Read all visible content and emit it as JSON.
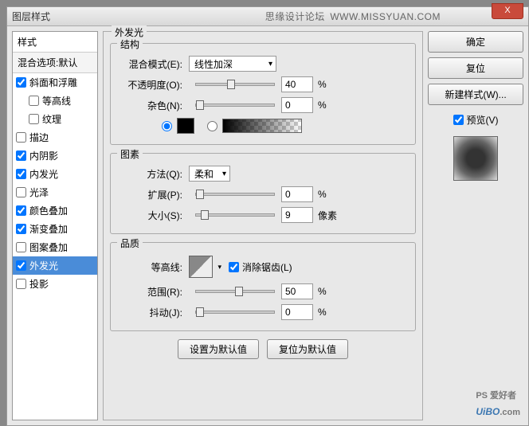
{
  "titlebar": {
    "title": "图层样式",
    "brand": "思缘设计论坛",
    "url": "WWW.MISSYUAN.COM"
  },
  "close": "X",
  "sidebar": {
    "header": "样式",
    "sub": "混合选项:默认",
    "items": [
      {
        "label": "斜面和浮雕",
        "checked": true,
        "indent": false
      },
      {
        "label": "等高线",
        "checked": false,
        "indent": true
      },
      {
        "label": "纹理",
        "checked": false,
        "indent": true
      },
      {
        "label": "描边",
        "checked": false,
        "indent": false
      },
      {
        "label": "内阴影",
        "checked": true,
        "indent": false
      },
      {
        "label": "内发光",
        "checked": true,
        "indent": false
      },
      {
        "label": "光泽",
        "checked": false,
        "indent": false
      },
      {
        "label": "颜色叠加",
        "checked": true,
        "indent": false
      },
      {
        "label": "渐变叠加",
        "checked": true,
        "indent": false
      },
      {
        "label": "图案叠加",
        "checked": false,
        "indent": false
      },
      {
        "label": "外发光",
        "checked": true,
        "indent": false,
        "selected": true
      },
      {
        "label": "投影",
        "checked": false,
        "indent": false
      }
    ]
  },
  "main": {
    "outer_title": "外发光",
    "structure": {
      "title": "结构",
      "blend_label": "混合模式(E):",
      "blend_value": "线性加深",
      "opacity_label": "不透明度(O):",
      "opacity_value": "40",
      "opacity_unit": "%",
      "noise_label": "杂色(N):",
      "noise_value": "0",
      "noise_unit": "%"
    },
    "elements": {
      "title": "图素",
      "technique_label": "方法(Q):",
      "technique_value": "柔和",
      "spread_label": "扩展(P):",
      "spread_value": "0",
      "spread_unit": "%",
      "size_label": "大小(S):",
      "size_value": "9",
      "size_unit": "像素"
    },
    "quality": {
      "title": "品质",
      "contour_label": "等高线:",
      "antialias_label": "消除锯齿(L)",
      "range_label": "范围(R):",
      "range_value": "50",
      "range_unit": "%",
      "jitter_label": "抖动(J):",
      "jitter_value": "0",
      "jitter_unit": "%"
    },
    "defaults": {
      "set": "设置为默认值",
      "reset": "复位为默认值"
    }
  },
  "right": {
    "ok": "确定",
    "cancel": "复位",
    "new_style": "新建样式(W)...",
    "preview": "预览(V)"
  },
  "watermark": {
    "brand": "UiBO",
    "suffix": ".com",
    "tag": "PS 爱好者"
  }
}
